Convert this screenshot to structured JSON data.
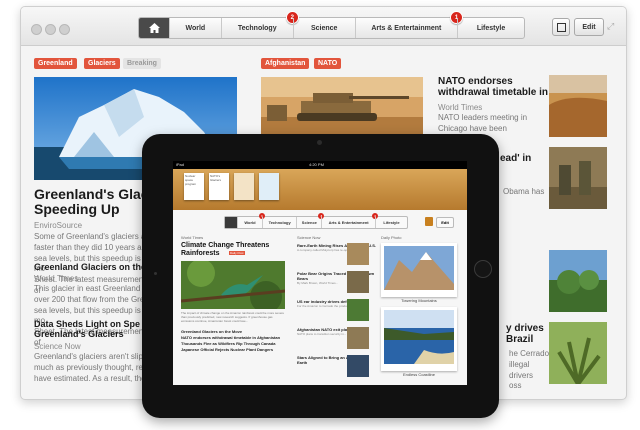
{
  "window": {
    "nav": {
      "items": [
        "World",
        "Technology",
        "Science",
        "Arts & Entertainment",
        "Lifestyle"
      ],
      "badges": {
        "science": "2",
        "lifestyle": "1"
      },
      "edit_label": "Edit"
    },
    "tags_left": [
      "Greenland",
      "Glaciers",
      "Breaking"
    ],
    "tags_middle": [
      "Afghanistan",
      "NATO"
    ],
    "lead": {
      "headline": "Greenland's Glacie",
      "headline_line2": "Speeding Up",
      "source": "EnviroSource",
      "body": [
        "Some of Greenland's glaciers are",
        "faster than they did 10 years ago,",
        "sea levels, but this speedup is mo",
        "Sheet. The latest measurements of"
      ]
    },
    "story2": {
      "headline": "Greenland Glaciers on the",
      "source": "World Times",
      "body": [
        "This glacier in east Greenland is",
        "over 200 that flow from the Gree",
        "sea levels, but this speedup is mo",
        "Sheet. The latest measurements of"
      ]
    },
    "story3": {
      "headline": "Data Sheds Light on Spe",
      "headline_line2": "Greenland's Glaciers",
      "source": "Science Now",
      "body": [
        "Greenland's glaciers aren't slipp",
        "much as previously thought, rese",
        "have estimated. As a result, the"
      ]
    },
    "right_story1": {
      "headline": "NATO endorses",
      "headline_line2": "withdrawal timetable in",
      "source": "World Times",
      "body": [
        "NATO leaders meeting in",
        "Chicago have been",
        "bead one",
        "command"
      ]
    },
    "right_story2": {
      "headline": "ead' in"
    },
    "right_story3": {
      "body": [
        "Obama has"
      ]
    },
    "right_story4": {
      "headline": "y drives",
      "headline_line2": "Brazil",
      "body": [
        "he Cerrado",
        "illegal",
        "drivers",
        "oss"
      ]
    }
  },
  "ipad": {
    "status_time": "4:20 PM",
    "status_carrier": "iPad",
    "shelf_thumbs": [
      "Nuclear space program",
      "NATO's Glaciers",
      "",
      ""
    ],
    "nav_items": [
      "World",
      "Technology",
      "Science",
      "Arts & Entertainment",
      "Lifestyle"
    ],
    "nav_badges": {
      "world": "1",
      "science": "3",
      "arts": "4"
    },
    "edit_label": "Edit",
    "col1_label": "World Times",
    "col2_label": "Science Now",
    "col3_label": "Daily Photo",
    "lead_headline": "Climate Change Threatens",
    "lead_headline2": "Rainforests",
    "lead_tag": "Daily Post",
    "lead_body": "The impact of climate change on the Amazon rainforest could be more severe than previously predicted, new research suggests. If greenhouse gas emissions continue, Amazonian forest could lose...",
    "list": [
      "Greenland Glaciers on the Move",
      "NATO endorses withdrawal timetable in Afghanistan",
      "Thousands Flee as Wildfires Rip Through Canada",
      "Japanese Official Rejects Nuclear Plant Dangers"
    ],
    "mid_items": [
      {
        "title": "Rare-Earth Mining Rises Again in the U.S.",
        "body": "A company called Molycorp has re-opened a mine..."
      },
      {
        "title": "Polar Bear Origins Traced to Irish Brown Bears",
        "body": "By Mark Brown, World Times..."
      },
      {
        "title": "US ear industry drives deforestat...",
        "body": "For the Amazon to Cerrado the production of..."
      },
      {
        "title": "Afghanistan NATO exit plan raises...",
        "body": "NATO plans to transition security in..."
      },
      {
        "title": "Stars Aligned to Bring an Asteroid to Earth",
        "body": ""
      }
    ],
    "photo1_caption": "Towering Mountains",
    "photo2_caption": "Endless Coastline"
  }
}
